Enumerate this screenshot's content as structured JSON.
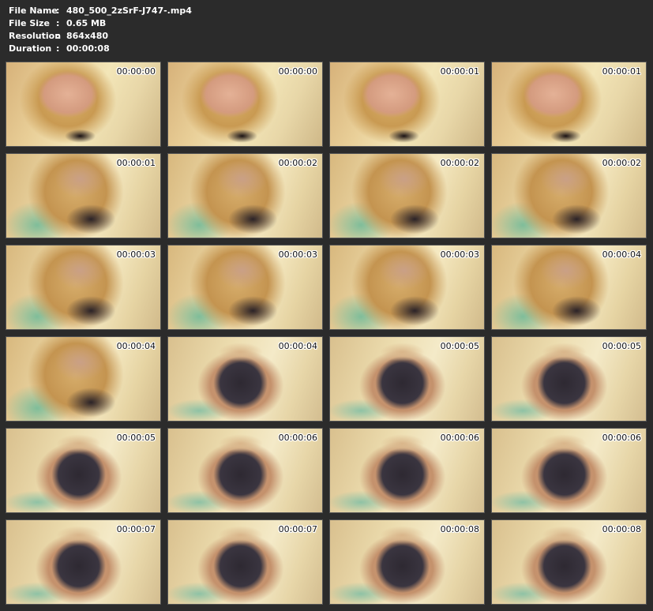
{
  "info": [
    {
      "label": "File Name",
      "sep": ":",
      "value": "480_500_2zSrF-J747-.mp4"
    },
    {
      "label": "File Size",
      "sep": ":",
      "value": "0.65 MB"
    },
    {
      "label": "Resolution",
      "sep": ":",
      "value": "864x480"
    },
    {
      "label": "Duration",
      "sep": ":",
      "value": "00:00:08"
    }
  ],
  "colors": {
    "background": "#2b2b2b",
    "text": "#ffffff"
  },
  "thumbnails": [
    {
      "timestamp": "00:00:00",
      "scene": "closeup"
    },
    {
      "timestamp": "00:00:00",
      "scene": "closeup"
    },
    {
      "timestamp": "00:00:01",
      "scene": "closeup"
    },
    {
      "timestamp": "00:00:01",
      "scene": "closeup"
    },
    {
      "timestamp": "00:00:01",
      "scene": "hair"
    },
    {
      "timestamp": "00:00:02",
      "scene": "hair"
    },
    {
      "timestamp": "00:00:02",
      "scene": "hair"
    },
    {
      "timestamp": "00:00:02",
      "scene": "hair"
    },
    {
      "timestamp": "00:00:03",
      "scene": "hair"
    },
    {
      "timestamp": "00:00:03",
      "scene": "hair"
    },
    {
      "timestamp": "00:00:03",
      "scene": "hair"
    },
    {
      "timestamp": "00:00:04",
      "scene": "hair"
    },
    {
      "timestamp": "00:00:04",
      "scene": "hair"
    },
    {
      "timestamp": "00:00:04",
      "scene": "corset"
    },
    {
      "timestamp": "00:00:05",
      "scene": "corset"
    },
    {
      "timestamp": "00:00:05",
      "scene": "corset"
    },
    {
      "timestamp": "00:00:05",
      "scene": "corset"
    },
    {
      "timestamp": "00:00:06",
      "scene": "corset"
    },
    {
      "timestamp": "00:00:06",
      "scene": "corset"
    },
    {
      "timestamp": "00:00:06",
      "scene": "corset"
    },
    {
      "timestamp": "00:00:07",
      "scene": "corset"
    },
    {
      "timestamp": "00:00:07",
      "scene": "corset"
    },
    {
      "timestamp": "00:00:08",
      "scene": "corset"
    },
    {
      "timestamp": "00:00:08",
      "scene": "corset"
    }
  ]
}
